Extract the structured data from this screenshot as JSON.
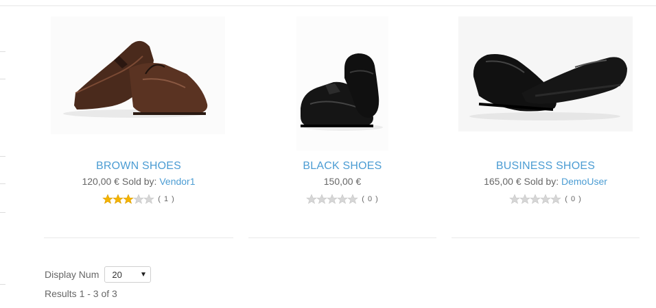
{
  "products": [
    {
      "title": "BROWN SHOES",
      "price": "120,00 €",
      "sold_by_prefix": " Sold by: ",
      "vendor": "Vendor1",
      "rating_stars": 3,
      "rating_count": "( 1 )",
      "image_icon": "brown-shoes-image"
    },
    {
      "title": "BLACK SHOES",
      "price": "150,00 €",
      "sold_by_prefix": "",
      "vendor": "",
      "rating_stars": 0,
      "rating_count": "( 0 )",
      "image_icon": "black-shoes-image"
    },
    {
      "title": "BUSINESS SHOES",
      "price": "165,00 €",
      "sold_by_prefix": " Sold by: ",
      "vendor": "DemoUser",
      "rating_stars": 0,
      "rating_count": "( 0 )",
      "image_icon": "business-shoes-image"
    }
  ],
  "display": {
    "label": "Display Num",
    "selected": "20"
  },
  "results": "Results 1 - 3 of 3",
  "colors": {
    "link": "#4b9cd3",
    "star_filled": "#f4b400",
    "star_empty": "#d6d6d6"
  }
}
